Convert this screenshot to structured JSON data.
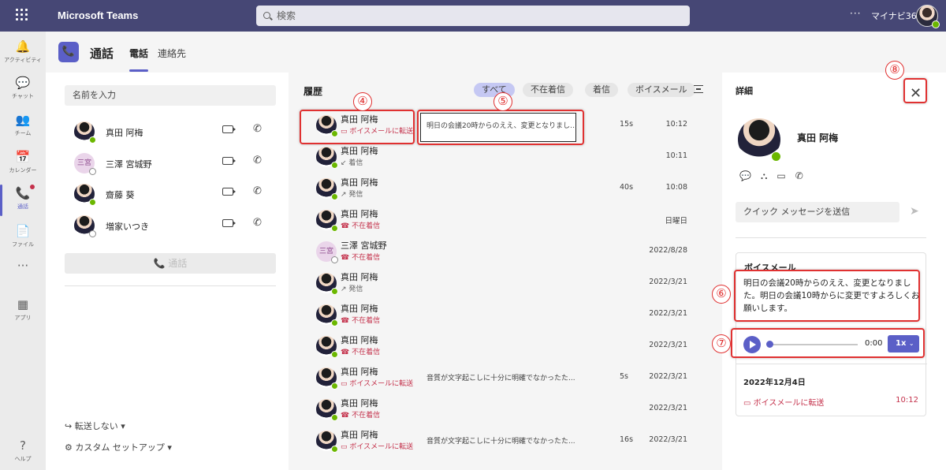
{
  "topbar": {
    "app_name": "Microsoft Teams",
    "search_placeholder": "検索",
    "more": "···",
    "tenant": "マイナビ365"
  },
  "rail": [
    {
      "label": "アクティビティ",
      "icon": "bell-icon",
      "glyph": "🔔"
    },
    {
      "label": "チャット",
      "icon": "chat-icon",
      "glyph": "💬"
    },
    {
      "label": "チーム",
      "icon": "teams-icon",
      "glyph": "👥"
    },
    {
      "label": "カレンダー",
      "icon": "calendar-icon",
      "glyph": "📅"
    },
    {
      "label": "通話",
      "icon": "phone-icon",
      "glyph": "📞",
      "active": true
    },
    {
      "label": "ファイル",
      "icon": "file-icon",
      "glyph": "📄"
    },
    {
      "label": "",
      "icon": "more-icon",
      "glyph": "···"
    },
    {
      "label": "アプリ",
      "icon": "apps-icon",
      "glyph": "▦"
    },
    {
      "label": "ヘルプ",
      "icon": "help-icon",
      "glyph": "?"
    }
  ],
  "header": {
    "title": "通話",
    "tabs": [
      "電話",
      "連絡先"
    ]
  },
  "left": {
    "name_placeholder": "名前を入力",
    "contacts": [
      {
        "name": "真田 阿梅",
        "avatar": "photo",
        "status": "available"
      },
      {
        "name": "三澤 宮城野",
        "avatar": "initials",
        "initials": "三宮",
        "status": "away"
      },
      {
        "name": "齋藤 葵",
        "avatar": "photo",
        "status": "available"
      },
      {
        "name": "増家いつき",
        "avatar": "photo",
        "status": "away"
      }
    ],
    "call_button": "通話",
    "forward": "転送しない",
    "custom_setup": "カスタム セットアップ"
  },
  "history": {
    "title": "履歴",
    "filters": [
      "すべて",
      "不在着信",
      "着信",
      "ボイスメール"
    ],
    "rows": [
      {
        "name": "真田 阿梅",
        "sub": "ボイスメールに転送",
        "type": "voicemail",
        "text": "明日の会議20時からのええ、変更となりまし...",
        "duration": "15s",
        "time": "10:12"
      },
      {
        "name": "真田 阿梅",
        "sub": "着信",
        "type": "incoming",
        "text": "",
        "duration": "",
        "time": "10:11"
      },
      {
        "name": "真田 阿梅",
        "sub": "発信",
        "type": "outgoing",
        "text": "",
        "duration": "40s",
        "time": "10:08"
      },
      {
        "name": "真田 阿梅",
        "sub": "不在着信",
        "type": "missed",
        "text": "",
        "duration": "",
        "time": "日曜日"
      },
      {
        "name": "三澤 宮城野",
        "sub": "不在着信",
        "type": "missed",
        "text": "",
        "duration": "",
        "time": "2022/8/28",
        "initials": "三宮"
      },
      {
        "name": "真田 阿梅",
        "sub": "発信",
        "type": "outgoing",
        "text": "",
        "duration": "",
        "time": "2022/3/21"
      },
      {
        "name": "真田 阿梅",
        "sub": "不在着信",
        "type": "missed",
        "text": "",
        "duration": "",
        "time": "2022/3/21"
      },
      {
        "name": "真田 阿梅",
        "sub": "不在着信",
        "type": "missed",
        "text": "",
        "duration": "",
        "time": "2022/3/21"
      },
      {
        "name": "真田 阿梅",
        "sub": "ボイスメールに転送",
        "type": "voicemail",
        "text": "音質が文字起こしに十分に明確でなかったた...",
        "duration": "5s",
        "time": "2022/3/21"
      },
      {
        "name": "真田 阿梅",
        "sub": "不在着信",
        "type": "missed",
        "text": "",
        "duration": "",
        "time": "2022/3/21"
      },
      {
        "name": "真田 阿梅",
        "sub": "ボイスメールに転送",
        "type": "voicemail",
        "text": "音質が文字起こしに十分に明確でなかったた...",
        "duration": "16s",
        "time": "2022/3/21"
      }
    ]
  },
  "details": {
    "title": "詳細",
    "name": "真田 阿梅",
    "quick_message": "クイック メッセージを送信",
    "voicemail_title": "ボイスメール",
    "voicemail_text": "明日の会議20時からのええ、変更となりました。明日の会議10時からに変更ですよろしくお願いします。",
    "player_time": "0:00",
    "player_speed": "1x",
    "date": "2022年12月4日",
    "forward_label": "ボイスメールに転送",
    "forward_time": "10:12"
  },
  "annotations": [
    "④",
    "⑤",
    "⑥",
    "⑦",
    "⑧"
  ],
  "colors": {
    "brand": "#5b5fc7",
    "topbar": "#464775",
    "missed": "#c4314b",
    "annotation": "#e03131",
    "available": "#6bb700"
  }
}
